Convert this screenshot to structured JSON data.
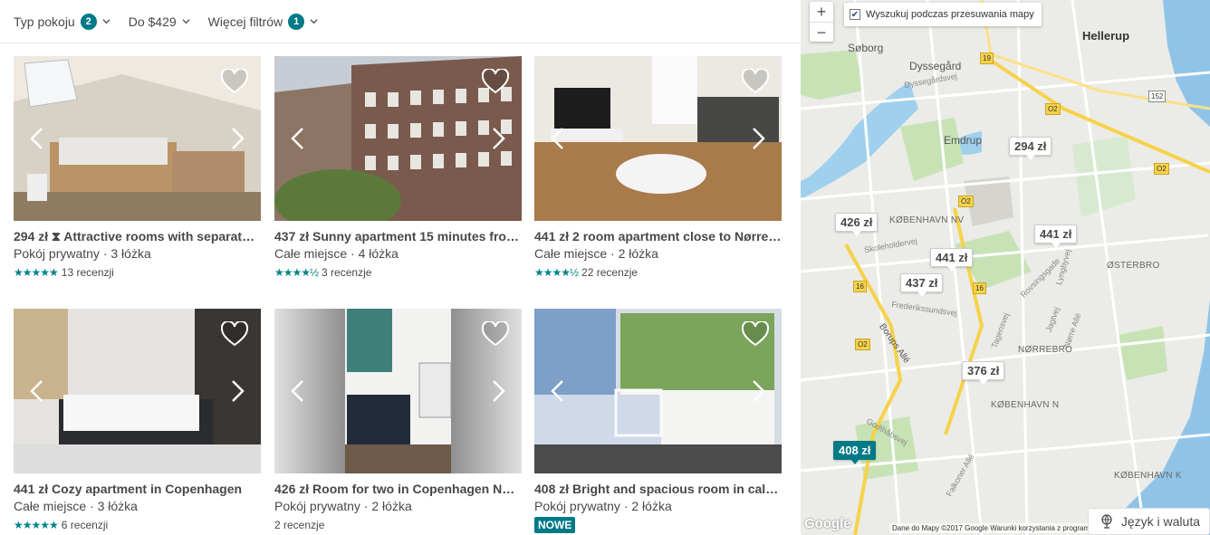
{
  "filters": [
    {
      "label": "Typ pokoju",
      "badge": "2"
    },
    {
      "label": "Do $429",
      "badge": ""
    },
    {
      "label": "Więcej filtrów",
      "badge": "1"
    }
  ],
  "listings": [
    {
      "price": "294 zł",
      "title": "Attractive rooms with separate ...",
      "sub": "Pokój prywatny · 3 łóżka",
      "stars": "★★★★★",
      "reviews": "13 recenzji",
      "instant": true
    },
    {
      "price": "437 zł",
      "title": "Sunny apartment 15 minutes from...",
      "sub": "Całe miejsce · 4 łóżka",
      "stars": "★★★★½",
      "reviews": "3 recenzje"
    },
    {
      "price": "441 zł",
      "title": "2 room apartment close to Nørreb...",
      "sub": "Całe miejsce · 2 łóżka",
      "stars": "★★★★½",
      "reviews": "22 recenzje"
    },
    {
      "price": "441 zł",
      "title": "Cozy apartment in Copenhagen",
      "sub": "Całe miejsce · 3 łóżka",
      "stars": "★★★★★",
      "reviews": "6 recenzji"
    },
    {
      "price": "426 zł",
      "title": "Room for two in Copenhagen Nor...",
      "sub": "Pokój prywatny · 2 łóżka",
      "stars": "",
      "reviews": "2 recenzje"
    },
    {
      "price": "408 zł",
      "title": "Bright and spacious room in calm ...",
      "sub": "Pokój prywatny · 2 łóżka",
      "badge": "NOWE"
    }
  ],
  "map": {
    "search_when_moving": "Wyszukuj podczas przesuwania mapy",
    "zoom_in": "+",
    "zoom_out": "−",
    "pins": [
      "294 zł",
      "426 zł",
      "441 zł",
      "437 zł",
      "441 zł",
      "376 zł",
      "408 zł"
    ],
    "labels": {
      "hellerup": "Hellerup",
      "soborg": "Søborg",
      "dyssegard": "Dyssegård",
      "emdrup": "Emdrup",
      "kbh_nv": "KØBENHAVN NV",
      "osterbro": "ØSTERBRO",
      "norrebro": "NØRREBRO",
      "kbh_n": "KØBENHAVN N",
      "kbh_k": "KØBENHAVN K",
      "borups_alle": "Borups Allé",
      "frederikssundsvej": "Frederikssundsvej",
      "skoleholdervej": "Skoleholdervej",
      "lyngbyvej": "Lyngbyvej",
      "tagensvej": "Tagensvej",
      "norre_alle": "Nørre Allé",
      "jagtvej": "Jagtvej",
      "dyssegardsvej": "Dyssegårdsvej",
      "rovsingsgade": "Rovsingsgade",
      "falkoner": "Falkoner Allé",
      "godthabsvej": "Godthåbsvej"
    },
    "shields": [
      "19",
      "152",
      "O2",
      "O2",
      "O2",
      "O2",
      "16",
      "O2",
      "16",
      "O2"
    ],
    "google": "Google",
    "footer": "Dane do Mapy ©2017 Google   Warunki korzystania z programu",
    "lang_button": "Język i waluta",
    "accent": "#007a87"
  }
}
